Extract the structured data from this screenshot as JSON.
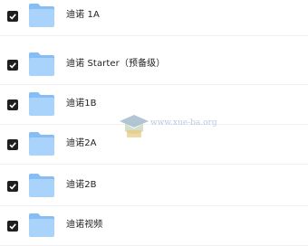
{
  "folders": [
    {
      "name": "迪诺 1A",
      "checked": true
    },
    {
      "name": "迪诺 Starter（预备级）",
      "checked": true
    },
    {
      "name": "迪诺1B",
      "checked": true
    },
    {
      "name": "迪诺2A",
      "checked": true
    },
    {
      "name": "迪诺2B",
      "checked": true
    },
    {
      "name": "迪诺视频",
      "checked": true
    }
  ],
  "watermark": {
    "text": "www.xue-ba.org"
  },
  "colors": {
    "folder_light": "#a9d3fb",
    "folder_dark": "#86bdf5",
    "checkbox": "#1f1f1f"
  }
}
